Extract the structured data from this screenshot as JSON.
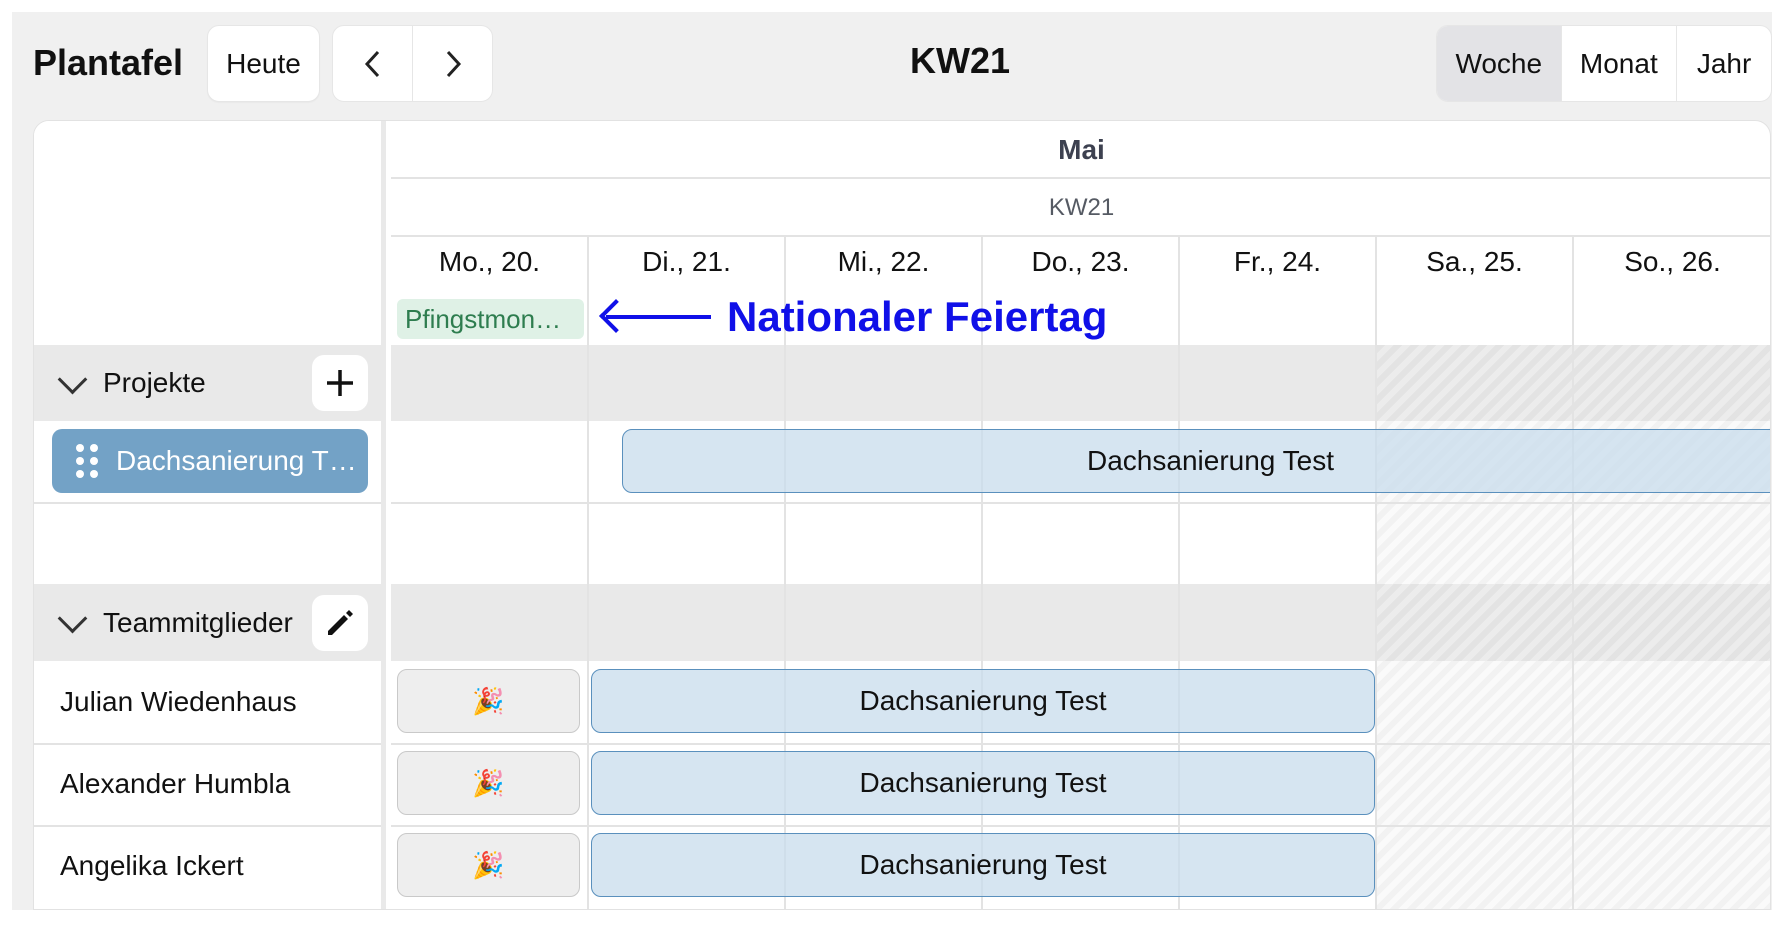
{
  "toolbar": {
    "title": "Plantafel",
    "today_label": "Heute",
    "prev_icon": "chevron-left-icon",
    "next_icon": "chevron-right-icon",
    "current_week": "KW21",
    "views": [
      "Woche",
      "Monat",
      "Jahr"
    ],
    "active_view": "Woche"
  },
  "calendar": {
    "month": "Mai",
    "week": "KW21",
    "days": [
      "Mo., 20.",
      "Di., 21.",
      "Mi., 22.",
      "Do., 23.",
      "Fr., 24.",
      "Sa., 25.",
      "So., 26."
    ],
    "holiday": "Pfingstmon…",
    "annotation": "Nationaler Feiertag"
  },
  "sections": {
    "projects": {
      "label": "Projekte",
      "action_icon": "plus-icon"
    },
    "team": {
      "label": "Teammitglieder",
      "action_icon": "pencil-icon"
    }
  },
  "project": {
    "chip_label": "Dachsanierung T…",
    "bar_label": "Dachsanierung Test"
  },
  "members": [
    {
      "name": "Julian Wiedenhaus",
      "holiday_emoji": "🎉",
      "assignment": "Dachsanierung Test"
    },
    {
      "name": "Alexander Humbla",
      "holiday_emoji": "🎉",
      "assignment": "Dachsanierung Test"
    },
    {
      "name": "Angelika Ickert",
      "holiday_emoji": "🎉",
      "assignment": "Dachsanierung Test"
    }
  ],
  "colors": {
    "bar_fill": "#d5e3ef",
    "bar_border": "#5a90bd",
    "project_chip": "#73a2c6",
    "holiday_tag": "#dff1e6",
    "annotation": "#1010e8"
  }
}
